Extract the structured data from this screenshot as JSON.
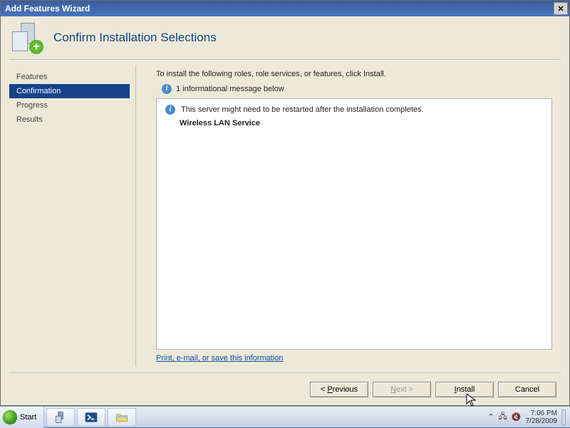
{
  "window": {
    "title": "Add Features Wizard",
    "heading": "Confirm Installation Selections"
  },
  "sidebar": {
    "items": [
      {
        "label": "Features",
        "active": false
      },
      {
        "label": "Confirmation",
        "active": true
      },
      {
        "label": "Progress",
        "active": false
      },
      {
        "label": "Results",
        "active": false
      }
    ]
  },
  "main": {
    "instruction": "To install the following roles, role services, or features, click Install.",
    "info_count_label": "1 informational message below",
    "restart_notice": "This server might need to be restarted after the installation completes.",
    "features": [
      "Wireless LAN Service"
    ],
    "save_link": "Print, e-mail, or save this information"
  },
  "buttons": {
    "previous": "< Previous",
    "next": "Next >",
    "install": "Install",
    "cancel": "Cancel"
  },
  "taskbar": {
    "start": "Start",
    "time": "7:06 PM",
    "date": "7/28/2009"
  }
}
